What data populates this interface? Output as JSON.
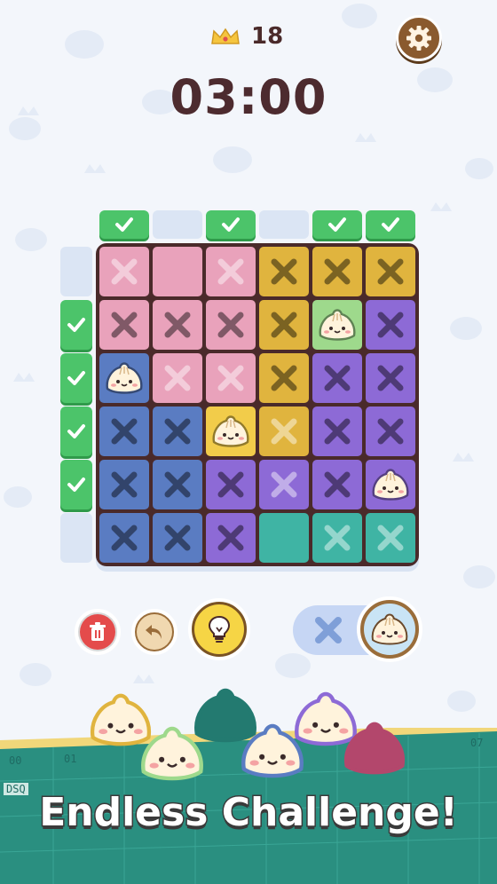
{
  "header": {
    "crown_count": "18",
    "timer": "03:00"
  },
  "icons": {
    "crown": "crown-icon",
    "settings": "gear-icon",
    "check": "check-icon",
    "cross": "x-mark-icon",
    "dumpling": "dumpling-icon",
    "delete": "trash-icon",
    "undo": "undo-icon",
    "hint": "lightbulb-icon"
  },
  "columns_solved": [
    true,
    false,
    true,
    false,
    true,
    true
  ],
  "rows_solved": [
    false,
    true,
    true,
    true,
    true,
    false
  ],
  "colors": {
    "pink": "#e9a2bb",
    "gold": "#e0b43e",
    "purple": "#8d6ad6",
    "blue": "#5a7cc2",
    "teal": "#3fb4a4",
    "green": "#9ed98c",
    "yellow": "#f2cc4a",
    "check_green": "#4cc46a",
    "dark": "#4a2a2a"
  },
  "board": [
    [
      {
        "c": "pink",
        "m": "xl"
      },
      {
        "c": "pink",
        "m": ""
      },
      {
        "c": "pink",
        "m": "xl"
      },
      {
        "c": "gold",
        "m": "x"
      },
      {
        "c": "gold",
        "m": "x"
      },
      {
        "c": "gold",
        "m": "x"
      }
    ],
    [
      {
        "c": "pink",
        "m": "x"
      },
      {
        "c": "pink",
        "m": "x"
      },
      {
        "c": "pink",
        "m": "x"
      },
      {
        "c": "gold",
        "m": "x"
      },
      {
        "c": "green",
        "m": "bun"
      },
      {
        "c": "purple",
        "m": "x"
      }
    ],
    [
      {
        "c": "blue",
        "m": "bun"
      },
      {
        "c": "pink",
        "m": "xl"
      },
      {
        "c": "pink",
        "m": "xl"
      },
      {
        "c": "gold",
        "m": "x"
      },
      {
        "c": "purple",
        "m": "x"
      },
      {
        "c": "purple",
        "m": "x"
      }
    ],
    [
      {
        "c": "blue",
        "m": "x"
      },
      {
        "c": "blue",
        "m": "x"
      },
      {
        "c": "yellow",
        "m": "bun"
      },
      {
        "c": "gold",
        "m": "xl"
      },
      {
        "c": "purple",
        "m": "x"
      },
      {
        "c": "purple",
        "m": "x"
      }
    ],
    [
      {
        "c": "blue",
        "m": "x"
      },
      {
        "c": "blue",
        "m": "x"
      },
      {
        "c": "purple",
        "m": "x"
      },
      {
        "c": "purple",
        "m": "xl"
      },
      {
        "c": "purple",
        "m": "x"
      },
      {
        "c": "purple",
        "m": "bun"
      }
    ],
    [
      {
        "c": "blue",
        "m": "x"
      },
      {
        "c": "blue",
        "m": "x"
      },
      {
        "c": "purple",
        "m": "x"
      },
      {
        "c": "teal",
        "m": ""
      },
      {
        "c": "teal",
        "m": "xl"
      },
      {
        "c": "teal",
        "m": "xl"
      }
    ]
  ],
  "controls": {
    "mode_selected": "dumpling"
  },
  "footer": {
    "banner": "Endless Challenge!",
    "mat_labels": [
      "00",
      "01",
      "DSQ",
      "07"
    ]
  }
}
